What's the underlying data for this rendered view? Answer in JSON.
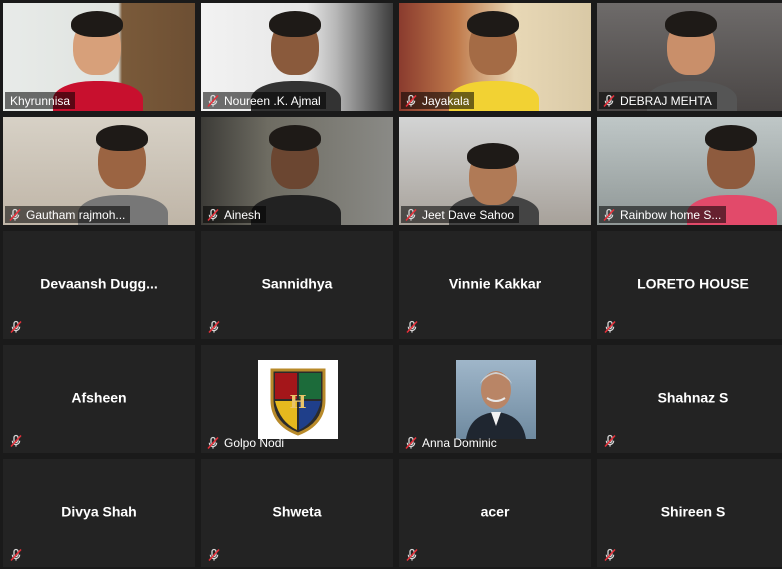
{
  "meeting": {
    "gallery": [
      {
        "name": "Khyrunnisa",
        "video": true,
        "active": true,
        "muted": false,
        "scene": "s1"
      },
      {
        "name": "Noureen .K. Ajmal",
        "video": true,
        "muted": true,
        "scene": "s2"
      },
      {
        "name": "Jayakala",
        "video": true,
        "muted": true,
        "scene": "s3"
      },
      {
        "name": "DEBRAJ MEHTA",
        "video": true,
        "muted": true,
        "scene": "s4"
      },
      {
        "name": "Gautham rajmoh...",
        "video": true,
        "muted": true,
        "scene": "s5"
      },
      {
        "name": "Ainesh",
        "video": true,
        "muted": true,
        "scene": "s6"
      },
      {
        "name": "Jeet Dave Sahoo",
        "video": true,
        "muted": true,
        "scene": "s7"
      },
      {
        "name": "Rainbow home S...",
        "video": true,
        "muted": true,
        "scene": "s8"
      },
      {
        "name": "Devaansh  Dugg...",
        "video": false,
        "muted": true
      },
      {
        "name": "Sannidhya",
        "video": false,
        "muted": true
      },
      {
        "name": "Vinnie Kakkar",
        "video": false,
        "muted": true
      },
      {
        "name": "LORETO HOUSE",
        "video": false,
        "muted": true
      },
      {
        "name": "Afsheen",
        "video": false,
        "muted": true
      },
      {
        "name": "Golpo Nodi",
        "video": false,
        "muted": true,
        "picture": "crest-avatar"
      },
      {
        "name": "Anna Dominic",
        "video": false,
        "muted": true,
        "picture": "photo-avatar"
      },
      {
        "name": "Shahnaz S",
        "video": false,
        "muted": true
      },
      {
        "name": "Divya Shah",
        "video": false,
        "muted": true
      },
      {
        "name": "Shweta",
        "video": false,
        "muted": true
      },
      {
        "name": "acer",
        "video": false,
        "muted": true
      },
      {
        "name": "Shireen S",
        "video": false,
        "muted": true
      }
    ]
  },
  "colors": {
    "active_speaker_border": "#c9dd5a",
    "tile_background": "#232323",
    "muted_icon": "#e5303a"
  }
}
